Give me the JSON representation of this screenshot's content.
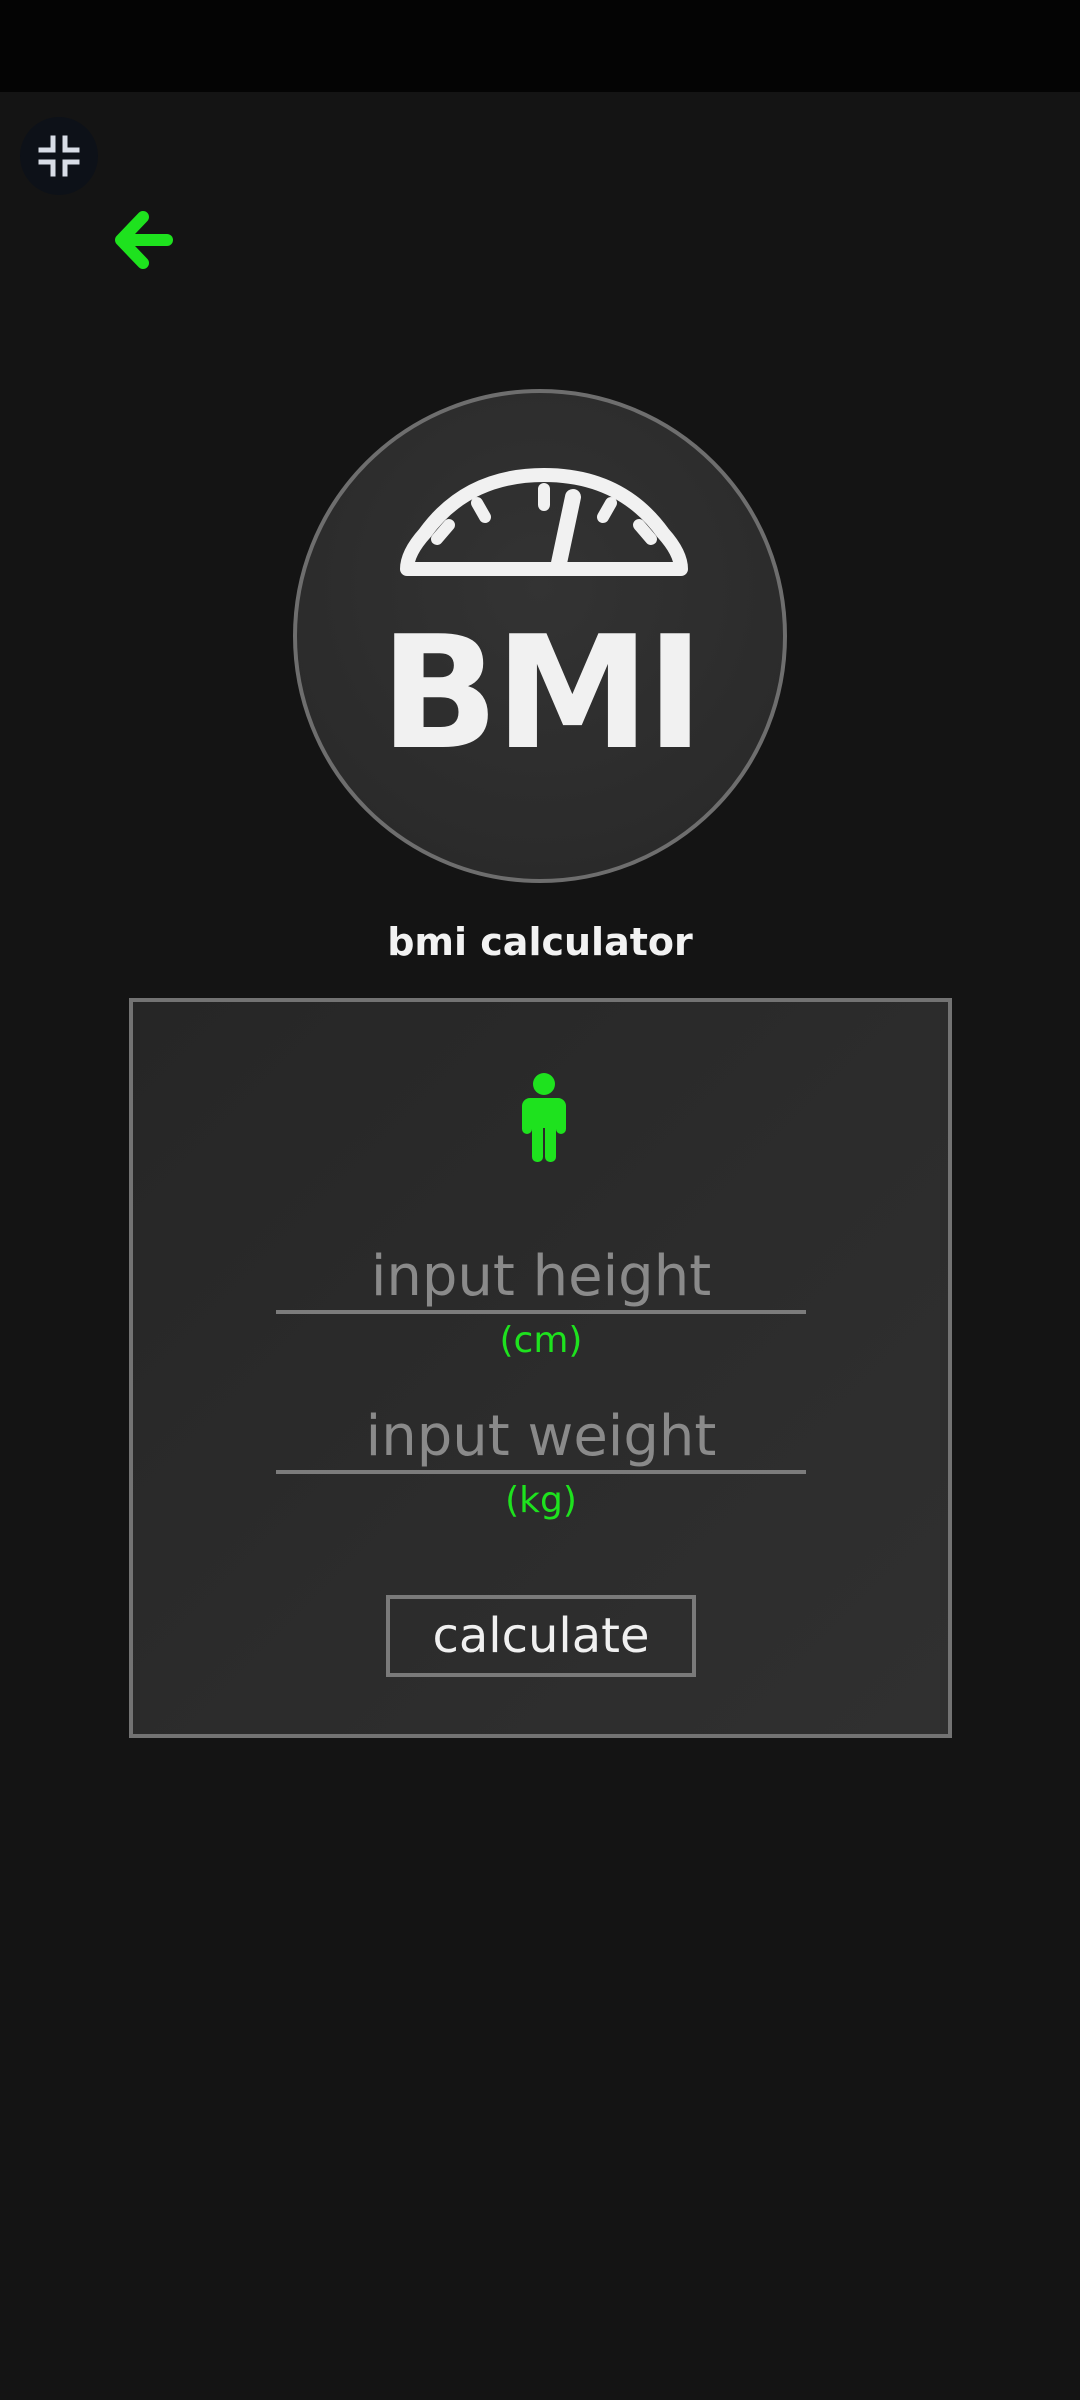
{
  "icons": {
    "exit_fullscreen": "exit-fullscreen-icon",
    "back": "arrow-left-icon",
    "gauge": "speedometer-icon",
    "person": "person-icon"
  },
  "colors": {
    "accent": "#1ee21e",
    "background": "#141414",
    "card": "#2a2a2a",
    "border": "#737373",
    "text": "#f2f2f2",
    "placeholder": "#8a8a8a"
  },
  "logo": {
    "text": "BMI"
  },
  "app": {
    "title": "bmi calculator"
  },
  "form": {
    "height": {
      "placeholder": "input height",
      "value": "",
      "unit": "(cm)"
    },
    "weight": {
      "placeholder": "input weight",
      "value": "",
      "unit": "(kg)"
    },
    "calculate_label": "calculate"
  }
}
